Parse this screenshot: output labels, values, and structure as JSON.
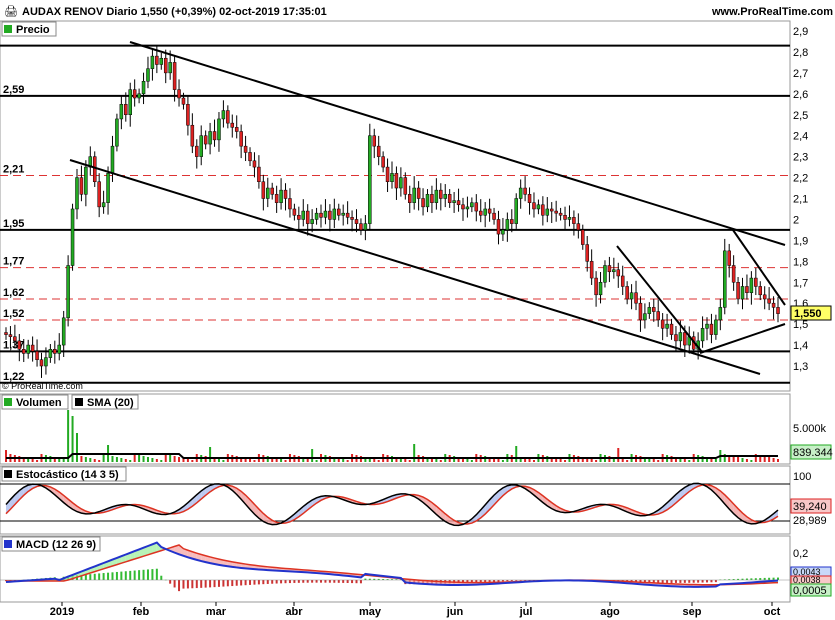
{
  "header": {
    "title": "AUDAX RENOV Diario 1,550 (+0,39%) 02-oct-2019 17:35:01",
    "site": "www.ProRealTime.com",
    "copyright": "© ProRealTime.com"
  },
  "panels": {
    "price": {
      "tab": "Precio"
    },
    "volume": {
      "tab": "Volumen",
      "tab2": "SMA (20)"
    },
    "stoch": {
      "tab": "Estocástico (14 3 5)"
    },
    "macd": {
      "tab": "MACD (12 26 9)"
    }
  },
  "colors": {
    "up": "#22aa22",
    "down": "#dd2222",
    "lastBox": "#ffff66",
    "greenBox": "#c8f0c8",
    "redBox": "#f8c8c8",
    "blueBox": "#c8d8f8",
    "macdLine": "#2233cc",
    "signalLine": "#dd3322"
  },
  "chart_data": [
    {
      "type": "candlestick",
      "title": "AUDAX RENOV Diario 1,550 (+0,39%) 02-oct-2019 17:35:01",
      "ylim": [
        1.2,
        2.95
      ],
      "y_ticks": [
        "2,9",
        "2,8",
        "2,7",
        "2,6",
        "2,5",
        "2,4",
        "2,3",
        "2,2",
        "2,1",
        "2",
        "1,9",
        "1,8",
        "1,7",
        "1,6",
        "1,5",
        "1,4",
        "1,3"
      ],
      "left_labels": [
        "2,59",
        "2,21",
        "1,95",
        "1,77",
        "1,62",
        "1,52",
        "1,37",
        "1,22"
      ],
      "horizontal_levels": [
        {
          "value": 2.83,
          "style": "solid"
        },
        {
          "value": 2.59,
          "style": "solid"
        },
        {
          "value": 2.21,
          "style": "dashed"
        },
        {
          "value": 1.95,
          "style": "solid"
        },
        {
          "value": 1.77,
          "style": "dashed"
        },
        {
          "value": 1.62,
          "style": "dashed"
        },
        {
          "value": 1.52,
          "style": "dashed"
        },
        {
          "value": 1.37,
          "style": "solid"
        },
        {
          "value": 1.22,
          "style": "solid"
        }
      ],
      "last_value": "1,550",
      "x_labels": [
        "2019",
        "feb",
        "mar",
        "abr",
        "may",
        "jun",
        "jul",
        "ago",
        "sep",
        "oct"
      ],
      "closes": [
        1.45,
        1.44,
        1.42,
        1.38,
        1.36,
        1.4,
        1.37,
        1.33,
        1.3,
        1.34,
        1.38,
        1.36,
        1.4,
        1.53,
        1.78,
        2.05,
        2.2,
        2.12,
        2.25,
        2.3,
        2.18,
        2.06,
        2.08,
        2.22,
        2.35,
        2.48,
        2.55,
        2.5,
        2.62,
        2.58,
        2.6,
        2.66,
        2.72,
        2.78,
        2.74,
        2.77,
        2.7,
        2.75,
        2.62,
        2.58,
        2.55,
        2.45,
        2.35,
        2.3,
        2.4,
        2.36,
        2.42,
        2.38,
        2.48,
        2.52,
        2.46,
        2.44,
        2.42,
        2.35,
        2.32,
        2.28,
        2.25,
        2.18,
        2.1,
        2.15,
        2.12,
        2.08,
        2.14,
        2.1,
        2.05,
        2.02,
        2.0,
        2.04,
        1.98,
        2.0,
        2.03,
        2.01,
        2.04,
        2.0,
        2.05,
        2.02,
        2.03,
        2.01,
        2.0,
        1.98,
        1.95,
        1.98,
        2.4,
        2.35,
        2.3,
        2.25,
        2.18,
        2.22,
        2.15,
        2.2,
        2.12,
        2.08,
        2.15,
        2.1,
        2.06,
        2.12,
        2.08,
        2.14,
        2.1,
        2.12,
        2.08,
        2.09,
        2.07,
        2.05,
        2.06,
        2.08,
        2.04,
        2.02,
        2.05,
        2.03,
        2.0,
        1.93,
        1.95,
        2.0,
        1.98,
        2.1,
        2.15,
        2.12,
        2.08,
        2.05,
        2.07,
        2.02,
        2.05,
        2.04,
        2.03,
        2.02,
        2.0,
        2.01,
        1.98,
        1.95,
        1.88,
        1.8,
        1.72,
        1.64,
        1.7,
        1.78,
        1.75,
        1.76,
        1.73,
        1.68,
        1.62,
        1.65,
        1.6,
        1.52,
        1.55,
        1.58,
        1.56,
        1.52,
        1.48,
        1.5,
        1.45,
        1.42,
        1.46,
        1.4,
        1.44,
        1.38,
        1.42,
        1.48,
        1.5,
        1.45,
        1.52,
        1.58,
        1.85,
        1.78,
        1.7,
        1.62,
        1.68,
        1.65,
        1.72,
        1.68,
        1.64,
        1.62,
        1.6,
        1.58,
        1.55
      ],
      "opens": [
        1.46,
        1.45,
        1.44,
        1.42,
        1.38,
        1.36,
        1.4,
        1.37,
        1.33,
        1.3,
        1.34,
        1.38,
        1.36,
        1.4,
        1.53,
        1.78,
        2.05,
        2.2,
        2.12,
        2.25,
        2.3,
        2.18,
        2.06,
        2.08,
        2.22,
        2.35,
        2.48,
        2.55,
        2.5,
        2.62,
        2.58,
        2.6,
        2.66,
        2.72,
        2.78,
        2.74,
        2.77,
        2.7,
        2.75,
        2.62,
        2.58,
        2.55,
        2.45,
        2.35,
        2.3,
        2.4,
        2.36,
        2.42,
        2.38,
        2.48,
        2.52,
        2.46,
        2.44,
        2.42,
        2.35,
        2.32,
        2.28,
        2.25,
        2.18,
        2.1,
        2.15,
        2.12,
        2.08,
        2.14,
        2.1,
        2.05,
        2.02,
        2.0,
        2.04,
        1.98,
        2.0,
        2.03,
        2.01,
        2.04,
        2.0,
        2.05,
        2.02,
        2.03,
        2.01,
        2.0,
        1.98,
        1.95,
        1.98,
        2.4,
        2.35,
        2.3,
        2.25,
        2.18,
        2.22,
        2.15,
        2.2,
        2.12,
        2.08,
        2.15,
        2.1,
        2.06,
        2.12,
        2.08,
        2.14,
        2.1,
        2.12,
        2.08,
        2.09,
        2.07,
        2.05,
        2.06,
        2.08,
        2.04,
        2.02,
        2.05,
        2.03,
        2.0,
        1.93,
        1.95,
        2.0,
        1.98,
        2.1,
        2.15,
        2.12,
        2.08,
        2.05,
        2.07,
        2.02,
        2.05,
        2.04,
        2.03,
        2.02,
        2.0,
        2.01,
        1.98,
        1.95,
        1.88,
        1.8,
        1.72,
        1.64,
        1.7,
        1.78,
        1.75,
        1.76,
        1.73,
        1.68,
        1.62,
        1.65,
        1.6,
        1.52,
        1.55,
        1.58,
        1.56,
        1.52,
        1.48,
        1.5,
        1.45,
        1.42,
        1.46,
        1.4,
        1.44,
        1.38,
        1.42,
        1.48,
        1.5,
        1.45,
        1.52,
        1.58,
        1.85,
        1.78,
        1.7,
        1.62,
        1.68,
        1.65,
        1.72,
        1.68,
        1.64,
        1.62,
        1.6,
        1.58
      ]
    },
    {
      "type": "bar",
      "title": "Volumen",
      "sma_label": "SMA (20)",
      "y_ticks": [
        "5.000k"
      ],
      "last_volume": "839.344"
    },
    {
      "type": "line",
      "title": "Estocástico (14 3 5)",
      "ylim": [
        0,
        100
      ],
      "y_ticks": [
        "100"
      ],
      "k_last": "39,240",
      "d_last": "28,989"
    },
    {
      "type": "line",
      "title": "MACD (12 26 9)",
      "y_ticks": [
        "0,2"
      ],
      "macd_last": "0,0043",
      "signal_last": "0,0038",
      "hist_last": "0,0005"
    }
  ]
}
